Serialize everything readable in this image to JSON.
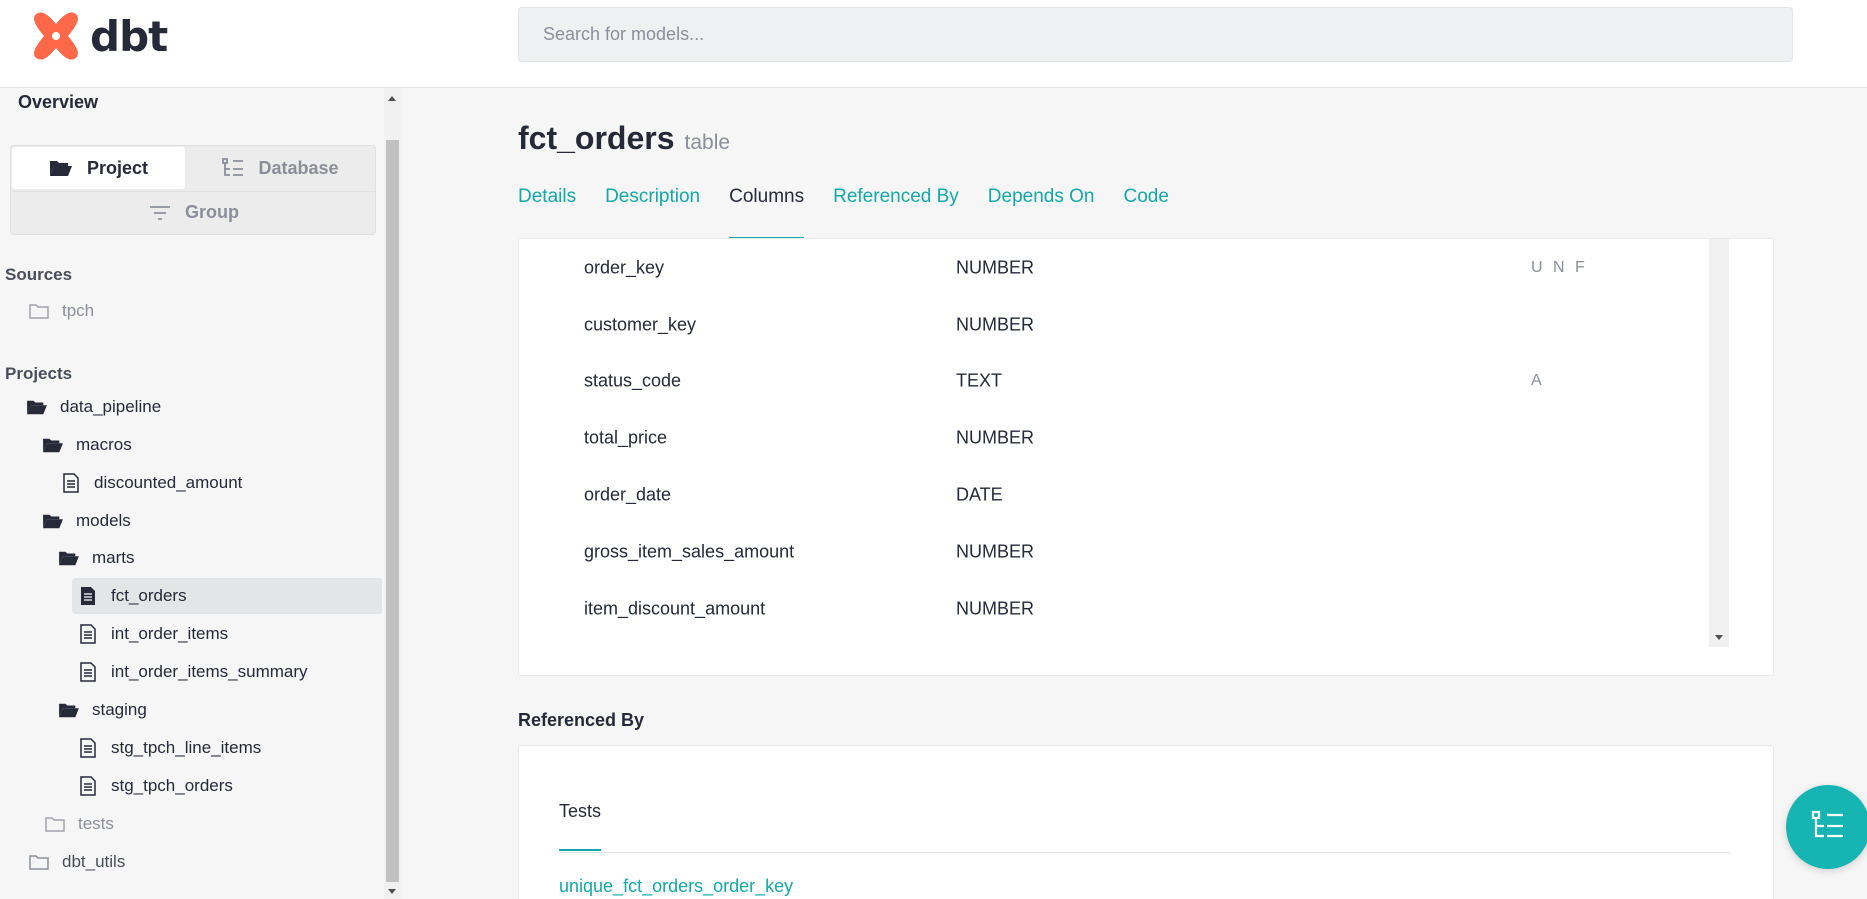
{
  "app": {
    "logo_text": "dbt",
    "brand_color": "#ff694a",
    "accent_color": "#14a8a6"
  },
  "search": {
    "placeholder": "Search for models..."
  },
  "sidebar": {
    "overview_label": "Overview",
    "tabs": {
      "project": "Project",
      "database": "Database",
      "group": "Group"
    },
    "sources_heading": "Sources",
    "sources": [
      {
        "label": "tpch",
        "icon": "folder-icon"
      }
    ],
    "projects_heading": "Projects",
    "tree": [
      {
        "label": "data_pipeline",
        "icon": "folder-open-icon"
      },
      {
        "label": "macros",
        "icon": "folder-open-icon"
      },
      {
        "label": "discounted_amount",
        "icon": "file-icon"
      },
      {
        "label": "models",
        "icon": "folder-open-icon"
      },
      {
        "label": "marts",
        "icon": "folder-open-icon"
      },
      {
        "label": "fct_orders",
        "icon": "file-filled-icon",
        "selected": true
      },
      {
        "label": "int_order_items",
        "icon": "file-icon"
      },
      {
        "label": "int_order_items_summary",
        "icon": "file-icon"
      },
      {
        "label": "staging",
        "icon": "folder-open-icon"
      },
      {
        "label": "stg_tpch_line_items",
        "icon": "file-icon"
      },
      {
        "label": "stg_tpch_orders",
        "icon": "file-icon"
      },
      {
        "label": "tests",
        "icon": "folder-icon"
      },
      {
        "label": "dbt_utils",
        "icon": "folder-icon"
      }
    ]
  },
  "model": {
    "name": "fct_orders",
    "type": "table"
  },
  "nav": {
    "tabs": [
      "Details",
      "Description",
      "Columns",
      "Referenced By",
      "Depends On",
      "Code"
    ],
    "active": "Columns"
  },
  "columns": [
    {
      "name": "order_key",
      "type": "NUMBER",
      "tests": "U N F",
      "expandable": true
    },
    {
      "name": "customer_key",
      "type": "NUMBER",
      "tests": "",
      "expandable": false
    },
    {
      "name": "status_code",
      "type": "TEXT",
      "tests": "A",
      "expandable": true
    },
    {
      "name": "total_price",
      "type": "NUMBER",
      "tests": "",
      "expandable": false
    },
    {
      "name": "order_date",
      "type": "DATE",
      "tests": "",
      "expandable": false
    },
    {
      "name": "gross_item_sales_amount",
      "type": "NUMBER",
      "tests": "",
      "expandable": false
    },
    {
      "name": "item_discount_amount",
      "type": "NUMBER",
      "tests": "",
      "expandable": false
    }
  ],
  "referenced_by": {
    "heading": "Referenced By",
    "tab": "Tests",
    "links": [
      "unique_fct_orders_order_key"
    ]
  }
}
